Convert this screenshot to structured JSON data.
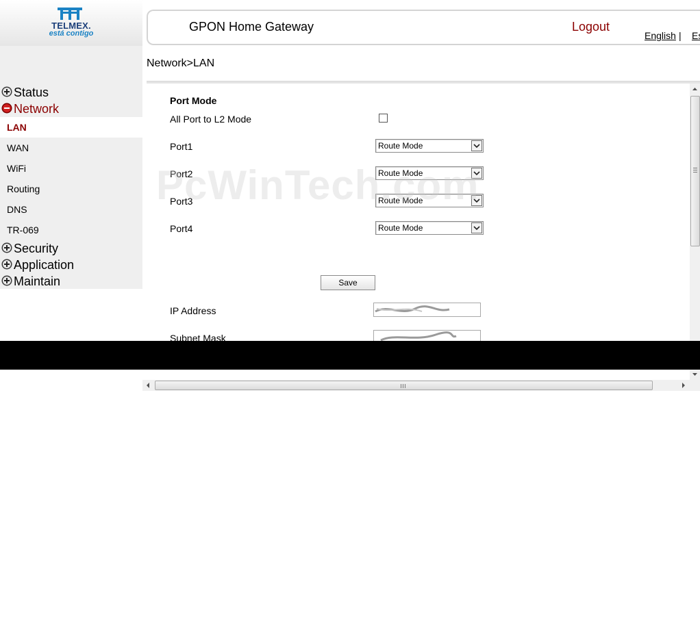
{
  "brand": {
    "logo_text": "TELMEX.",
    "tagline": "está contigo"
  },
  "header": {
    "title": "GPON Home Gateway",
    "logout": "Logout",
    "lang_english": "English",
    "lang_separator": "|",
    "lang_espanol": "Es"
  },
  "sidebar": {
    "sections": [
      {
        "label": "Status",
        "state": "collapsed"
      },
      {
        "label": "Network",
        "state": "expanded"
      },
      {
        "label": "Security",
        "state": "collapsed"
      },
      {
        "label": "Application",
        "state": "collapsed"
      },
      {
        "label": "Maintain",
        "state": "collapsed"
      }
    ],
    "network_items": [
      {
        "label": "LAN",
        "selected": true
      },
      {
        "label": "WAN"
      },
      {
        "label": "WiFi"
      },
      {
        "label": "Routing"
      },
      {
        "label": "DNS"
      },
      {
        "label": "TR-069"
      }
    ]
  },
  "breadcrumb": "Network>LAN",
  "form": {
    "section_title": "Port Mode",
    "l2_mode_label": "All Port to L2 Mode",
    "l2_mode_checked": false,
    "ports": [
      {
        "label": "Port1",
        "value": "Route Mode"
      },
      {
        "label": "Port2",
        "value": "Route Mode"
      },
      {
        "label": "Port3",
        "value": "Route Mode"
      },
      {
        "label": "Port4",
        "value": "Route Mode"
      }
    ],
    "save_label": "Save",
    "ip_address_label": "IP Address",
    "subnet_mask_label": "Subnet Mask"
  },
  "watermark": "PcWinTech.com",
  "colors": {
    "accent": "#8b0000",
    "sidebar_bg": "#efefef",
    "brand_blue": "#1a82c4"
  }
}
